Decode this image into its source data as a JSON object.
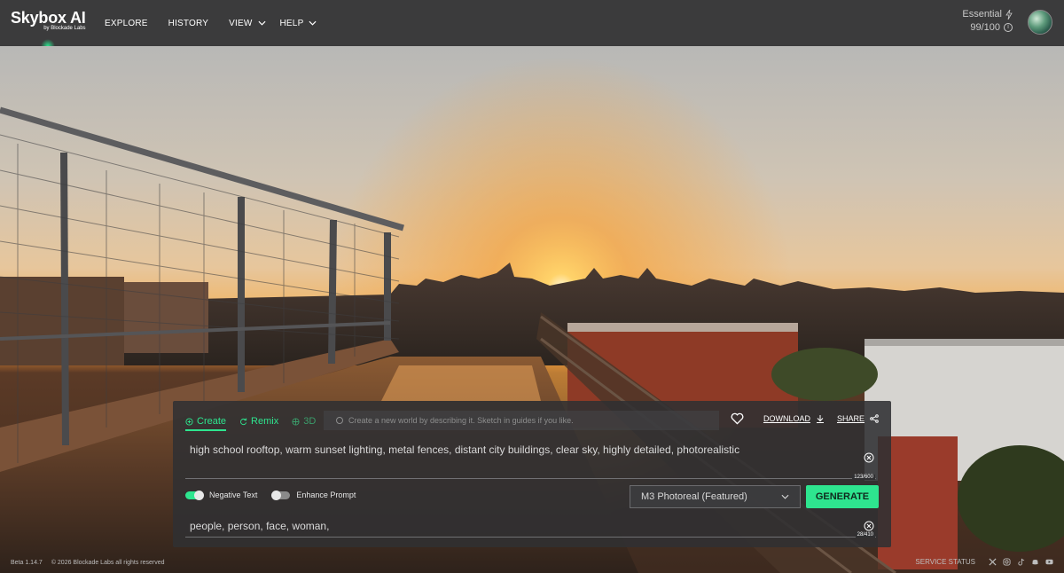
{
  "header": {
    "logo_main": "Skybox AI",
    "logo_sub": "by Blockade Labs",
    "nav": [
      {
        "label": "EXPLORE",
        "dropdown": false
      },
      {
        "label": "HISTORY",
        "dropdown": false
      },
      {
        "label": "VIEW",
        "dropdown": true
      },
      {
        "label": "HELP",
        "dropdown": true
      }
    ],
    "plan_name": "Essential",
    "credits": "99/100"
  },
  "panel": {
    "tabs": [
      {
        "label": "Create",
        "icon": "plus-circle-icon"
      },
      {
        "label": "Remix",
        "icon": "refresh-icon"
      },
      {
        "label": "3D",
        "icon": "cube-icon"
      }
    ],
    "hint": "Create a new world by describing it. Sketch in guides if you like.",
    "download_label": "DOWNLOAD",
    "share_label": "SHARE",
    "prompt": "high school rooftop, warm sunset lighting, metal fences, distant city buildings, clear sky, highly detailed, photorealistic",
    "prompt_count": "123/600",
    "negative_toggle_label": "Negative Text",
    "negative_toggle_on": true,
    "enhance_toggle_label": "Enhance Prompt",
    "enhance_toggle_on": false,
    "model": "M3 Photoreal (Featured)",
    "generate_label": "GENERATE",
    "negative_text": "people, person, face, woman,",
    "negative_count": "28/410"
  },
  "footer": {
    "version": "Beta 1.14.7",
    "copyright": "© 2026 Blockade Labs all rights reserved",
    "service_status": "SERVICE STATUS",
    "social_icons": [
      "x-icon",
      "instagram-icon",
      "tiktok-icon",
      "discord-icon",
      "youtube-icon"
    ]
  },
  "colors": {
    "accent": "#2ee58f",
    "header_bg": "#3b3b3c",
    "panel_bg": "#303032"
  }
}
